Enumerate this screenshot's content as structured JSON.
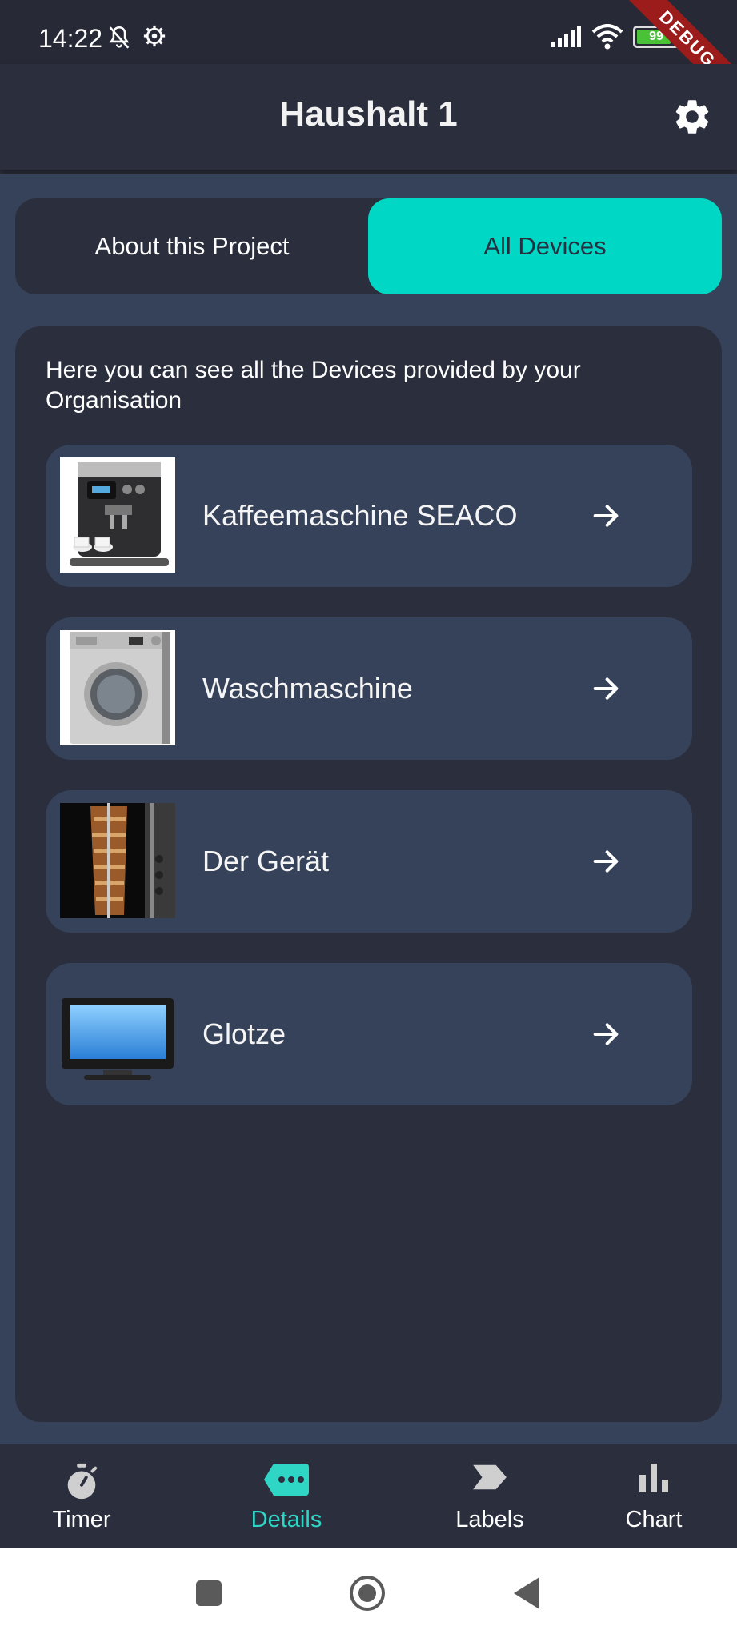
{
  "status_bar": {
    "time": "14:22",
    "battery_level": "99",
    "debug_label": "DEBUG"
  },
  "app_bar": {
    "title": "Haushalt 1",
    "settings_icon": "gear-icon"
  },
  "segmented_control": {
    "about_label": "About this Project",
    "all_devices_label": "All Devices",
    "selected": "All Devices",
    "accent_color": "#00d7c4"
  },
  "panel": {
    "intro_text": "Here you can see all the Devices provided by your Organisation"
  },
  "devices": [
    {
      "name": "Kaffeemaschine SEACO",
      "thumbnail": "coffee-machine-image"
    },
    {
      "name": "Waschmaschine",
      "thumbnail": "washing-machine-image"
    },
    {
      "name": "Der Gerät",
      "thumbnail": "doner-grill-image"
    },
    {
      "name": "Glotze",
      "thumbnail": "television-image"
    }
  ],
  "bottom_nav": {
    "items": [
      {
        "label": "Timer",
        "icon": "stopwatch-icon"
      },
      {
        "label": "Details",
        "icon": "tag-dots-icon",
        "active": true
      },
      {
        "label": "Labels",
        "icon": "label-icon"
      },
      {
        "label": "Chart",
        "icon": "bar-chart-icon"
      }
    ],
    "active_color": "#2fd6c6"
  },
  "colors": {
    "background": "#2b2f3d",
    "card": "#364259"
  }
}
